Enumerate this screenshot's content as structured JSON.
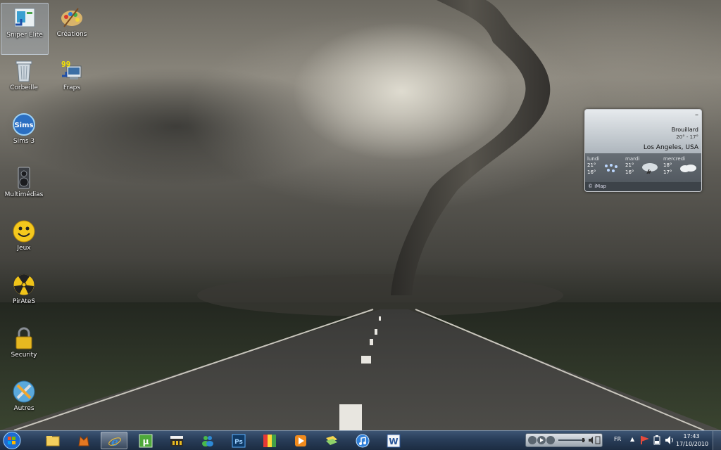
{
  "desktop": {
    "icons": [
      {
        "label": "Sniper Elite",
        "icon": "sniper-elite-shortcut-icon",
        "selected": true
      },
      {
        "label": "Créations",
        "icon": "palette-icon"
      },
      {
        "label": "Corbeille",
        "icon": "recycle-bin-icon"
      },
      {
        "label": "Fraps",
        "icon": "fraps-icon",
        "badge": "99"
      },
      {
        "label": "Sims 3",
        "icon": "sims-icon",
        "badge": "Sims"
      },
      {
        "label": "Multimédias",
        "icon": "speaker-icon"
      },
      {
        "label": "Jeux",
        "icon": "smiley-icon"
      },
      {
        "label": "PirAteS",
        "icon": "radiation-icon"
      },
      {
        "label": "Security",
        "icon": "padlock-icon"
      },
      {
        "label": "Autres",
        "icon": "tools-icon"
      }
    ]
  },
  "weather_gadget": {
    "close_label": "–",
    "condition": "Brouillard",
    "temps": "20° - 17°",
    "city": "Los Angeles, USA",
    "forecast": [
      {
        "day": "lundi",
        "hi": "21°",
        "lo": "16°",
        "icon": "snow-icon"
      },
      {
        "day": "mardi",
        "hi": "21°",
        "lo": "16°",
        "icon": "storm-icon"
      },
      {
        "day": "mercredi",
        "hi": "18°",
        "lo": "17°",
        "icon": "cloud-icon"
      }
    ],
    "footer": "© iMap"
  },
  "taskbar": {
    "apps": [
      {
        "name": "file-explorer-icon"
      },
      {
        "name": "fox-app-icon"
      },
      {
        "name": "internet-explorer-icon",
        "active": true
      },
      {
        "name": "utorrent-icon"
      },
      {
        "name": "media-321-icon"
      },
      {
        "name": "messenger-icon"
      },
      {
        "name": "photoshop-icon"
      },
      {
        "name": "color-app-icon"
      },
      {
        "name": "media-player-icon"
      },
      {
        "name": "folders-icon"
      },
      {
        "name": "itunes-icon"
      },
      {
        "name": "word-icon"
      }
    ],
    "tray": {
      "language": "FR",
      "time": "17:43",
      "date": "17/10/2010"
    },
    "colors": {
      "bar": "#2a3f5b",
      "accent": "#7c92ad"
    }
  }
}
